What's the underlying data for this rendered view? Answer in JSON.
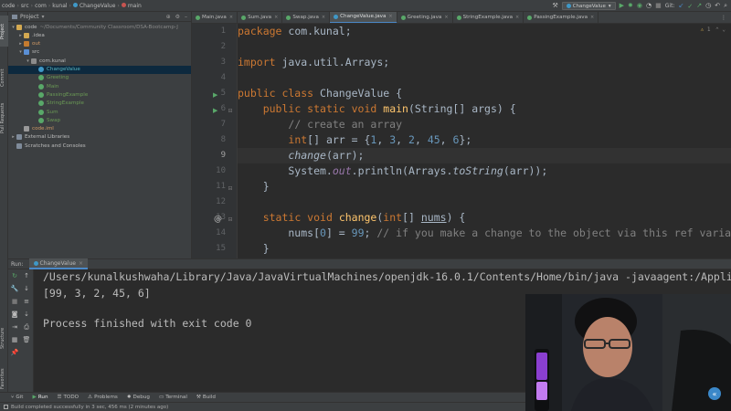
{
  "navbar": {
    "breadcrumbs": [
      "code",
      "src",
      "com",
      "kunal",
      "ChangeValue",
      "main"
    ],
    "run_config": "ChangeValue",
    "git_label": "Git:"
  },
  "project_panel": {
    "title": "Project",
    "tree": [
      {
        "label": "code",
        "extra": "~/Documents/Community Classroom/DSA-Bootcamp-J",
        "icon": "folder-icon",
        "indent": 0,
        "arrow": "▾"
      },
      {
        "label": ".idea",
        "icon": "folder-icon",
        "indent": 1,
        "arrow": "▸"
      },
      {
        "label": "out",
        "icon": "excluded-folder-icon",
        "indent": 1,
        "arrow": "▸",
        "color": "orange"
      },
      {
        "label": "src",
        "icon": "source-folder-icon",
        "indent": 1,
        "arrow": "▾"
      },
      {
        "label": "com.kunal",
        "icon": "package-icon",
        "indent": 2,
        "arrow": "▾"
      },
      {
        "label": "ChangeValue",
        "icon": "class-icon",
        "indent": 3,
        "arrow": "",
        "color": "cyan",
        "selected": true
      },
      {
        "label": "Greeting",
        "icon": "main-class-icon",
        "indent": 3,
        "arrow": "",
        "color": "green"
      },
      {
        "label": "Main",
        "icon": "main-class-icon",
        "indent": 3,
        "arrow": "",
        "color": "green"
      },
      {
        "label": "PassingExample",
        "icon": "main-class-icon",
        "indent": 3,
        "arrow": "",
        "color": "green"
      },
      {
        "label": "StringExample",
        "icon": "main-class-icon",
        "indent": 3,
        "arrow": "",
        "color": "green"
      },
      {
        "label": "Sum",
        "icon": "main-class-icon",
        "indent": 3,
        "arrow": "",
        "color": "green"
      },
      {
        "label": "Swap",
        "icon": "main-class-icon",
        "indent": 3,
        "arrow": "",
        "color": "green"
      },
      {
        "label": "code.iml",
        "icon": "module-file-icon",
        "indent": 1,
        "arrow": "",
        "color": "orange"
      },
      {
        "label": "External Libraries",
        "icon": "library-icon",
        "indent": 0,
        "arrow": "▸"
      },
      {
        "label": "Scratches and Consoles",
        "icon": "scratches-icon",
        "indent": 0,
        "arrow": ""
      }
    ]
  },
  "left_strip": {
    "tabs": [
      "Project",
      "Commit",
      "Pull Requests",
      "Structure",
      "Favorites"
    ]
  },
  "editor_tabs": [
    {
      "label": "Main.java",
      "active": false
    },
    {
      "label": "Sum.java",
      "active": false
    },
    {
      "label": "Swap.java",
      "active": false
    },
    {
      "label": "ChangeValue.java",
      "active": true
    },
    {
      "label": "Greeting.java",
      "active": false
    },
    {
      "label": "StringExample.java",
      "active": false
    },
    {
      "label": "PassingExample.java",
      "active": false
    }
  ],
  "editor": {
    "line_numbers": [
      "1",
      "2",
      "3",
      "4",
      "5",
      "6",
      "7",
      "8",
      "9",
      "10",
      "11",
      "12",
      "13",
      "14",
      "15"
    ],
    "warning_count": "1",
    "current_line": 9
  },
  "run_panel": {
    "label": "Run:",
    "tab": "ChangeValue",
    "console": [
      "/Users/kunalkushwaha/Library/Java/JavaVirtualMachines/openjdk-16.0.1/Contents/Home/bin/java -javaagent:/Application",
      "[99, 3, 2, 45, 6]",
      "",
      "Process finished with exit code 0"
    ]
  },
  "tool_windows": [
    {
      "label": "Git",
      "active": false
    },
    {
      "label": "Run",
      "active": true
    },
    {
      "label": "TODO",
      "active": false
    },
    {
      "label": "Problems",
      "active": false
    },
    {
      "label": "Debug",
      "active": false
    },
    {
      "label": "Terminal",
      "active": false
    },
    {
      "label": "Build",
      "active": false
    }
  ],
  "status_bar": {
    "message": "Build completed successfully in 3 sec, 456 ms (2 minutes ago)"
  },
  "colors": {
    "keyword": "#cc7832",
    "function": "#ffc66d",
    "comment": "#808080",
    "number": "#6897bb",
    "field": "#9876aa",
    "accent": "#4a88c7"
  }
}
